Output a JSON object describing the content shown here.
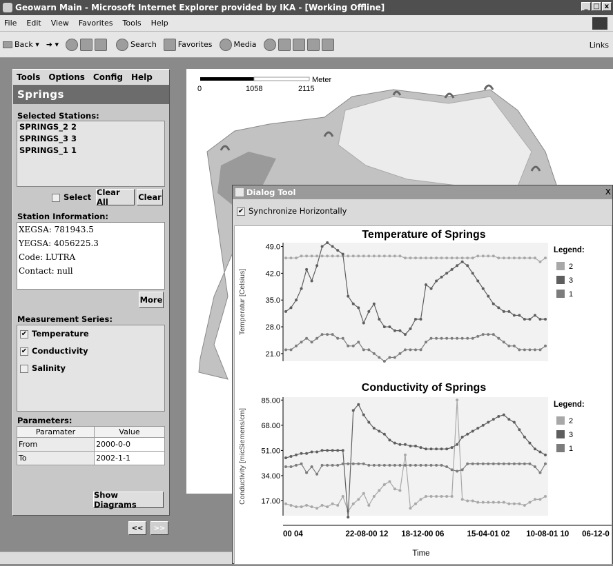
{
  "browser": {
    "title": "Geowarn Main - Microsoft Internet Explorer provided by IKA - [Working Offline]",
    "window_buttons": [
      "_",
      "□",
      "x"
    ],
    "menu": [
      "File",
      "Edit",
      "View",
      "Favorites",
      "Tools",
      "Help"
    ],
    "toolbar": {
      "back": "Back",
      "search": "Search",
      "favorites": "Favorites",
      "media": "Media",
      "links": "Links"
    }
  },
  "map": {
    "scale_unit": "Meter",
    "scale_ticks": [
      "0",
      "1058",
      "2115"
    ]
  },
  "left": {
    "menu": [
      "Tools",
      "Options",
      "Config",
      "Help"
    ],
    "title": "Springs",
    "selected_label": "Selected Stations:",
    "stations": [
      "SPRINGS_2 2",
      "SPRINGS_3 3",
      "SPRINGS_1 1"
    ],
    "select_label": "Select",
    "clear_all": "Clear All",
    "clear": "Clear",
    "info_label": "Station Information:",
    "info": [
      "XEGSA: 781943.5",
      "YEGSA: 4056225.3",
      "Code: LUTRA",
      "Contact: null"
    ],
    "more": "More",
    "series_label": "Measurement Series:",
    "series": [
      {
        "label": "Temperature",
        "checked": true
      },
      {
        "label": "Conductivity",
        "checked": true
      },
      {
        "label": "Salinity",
        "checked": false
      }
    ],
    "params_label": "Parameters:",
    "params_header": [
      "Paramater",
      "Value"
    ],
    "params": [
      [
        "From",
        "2000-0-0"
      ],
      [
        "To",
        "2002-1-1"
      ]
    ],
    "show_diagrams": "Show Diagrams",
    "nav_prev": "<<",
    "nav_next": ">>"
  },
  "dialog": {
    "title": "Dialog Tool",
    "close": "x",
    "sync_label": "Synchronize Horizontally",
    "x_ticks": [
      "00 04",
      "22-08-00 12",
      "18-12-00 06",
      "15-04-01 02",
      "10-08-01 10",
      "06-12-0"
    ],
    "x_label": "Time"
  },
  "chart_data": [
    {
      "type": "line",
      "title": "Temperature of Springs",
      "ylabel": "Temperatur [Celsius]",
      "ylim": [
        19,
        50
      ],
      "y_ticks": [
        "49.0",
        "42.0",
        "35.0",
        "28.0",
        "21.0"
      ],
      "legend_title": "Legend:",
      "legend_position": "right",
      "x": [
        0,
        2,
        4,
        6,
        8,
        10,
        12,
        14,
        16,
        18,
        20,
        22,
        24,
        26,
        28,
        30,
        32,
        34,
        36,
        38,
        40,
        42,
        44,
        46,
        48,
        50,
        52,
        54,
        56,
        58,
        60,
        62,
        64,
        66,
        68,
        70,
        72,
        74,
        76,
        78,
        80,
        82,
        84,
        86,
        88,
        90,
        92,
        94,
        96,
        98,
        100
      ],
      "series": [
        {
          "name": "2",
          "color": "#a8a8a8",
          "values": [
            46,
            46,
            46,
            46.5,
            46.5,
            46.5,
            46.5,
            46.5,
            46.5,
            46.5,
            46.5,
            46.5,
            46.5,
            46.5,
            46.5,
            46.5,
            46.5,
            46.5,
            46.5,
            46.5,
            46.5,
            46.5,
            46.5,
            46,
            46,
            46,
            46,
            46,
            46,
            46,
            46,
            46,
            46,
            46,
            46,
            46,
            46,
            46.5,
            46.5,
            46.5,
            46.5,
            46,
            46,
            46,
            46,
            46,
            46,
            46,
            46,
            45,
            46
          ]
        },
        {
          "name": "3",
          "color": "#5e5e5e",
          "values": [
            32,
            33,
            35,
            38,
            43,
            40,
            44,
            49,
            50,
            49,
            48,
            47,
            36,
            34,
            33,
            29,
            32,
            34,
            30,
            28,
            28,
            27,
            27,
            26,
            27.5,
            30,
            30,
            39,
            38,
            40,
            41,
            42,
            43,
            44,
            45,
            44,
            42,
            40,
            38,
            36,
            34,
            33,
            32,
            32,
            31,
            31,
            30,
            30,
            31,
            30,
            30
          ]
        },
        {
          "name": "1",
          "color": "#7c7c7c",
          "values": [
            22,
            22,
            23,
            24,
            25,
            24,
            25,
            26,
            26,
            26,
            25,
            25,
            23,
            23,
            24,
            22,
            22,
            21,
            20,
            19,
            20,
            20,
            21,
            22,
            22,
            22,
            22,
            24,
            25,
            25,
            25,
            25,
            25,
            25,
            25,
            25,
            25,
            25.5,
            26,
            26,
            26,
            25,
            24,
            23,
            23,
            22,
            22,
            22,
            22,
            22,
            23
          ]
        }
      ]
    },
    {
      "type": "line",
      "title": "Conductivity of Springs",
      "ylabel": "Conductivity [micSiemens/cm]",
      "ylim": [
        7,
        87
      ],
      "y_ticks": [
        "85.00",
        "68.00",
        "51.00",
        "34.00",
        "17.00"
      ],
      "legend_title": "Legend:",
      "legend_position": "right",
      "x": [
        0,
        2,
        4,
        6,
        8,
        10,
        12,
        14,
        16,
        18,
        20,
        22,
        24,
        26,
        28,
        30,
        32,
        34,
        36,
        38,
        40,
        42,
        44,
        46,
        48,
        50,
        52,
        54,
        56,
        58,
        60,
        62,
        64,
        66,
        68,
        70,
        72,
        74,
        76,
        78,
        80,
        82,
        84,
        86,
        88,
        90,
        92,
        94,
        96,
        98,
        100
      ],
      "series": [
        {
          "name": "2",
          "color": "#a8a8a8",
          "values": [
            15,
            14,
            13,
            13,
            14,
            13,
            12,
            14,
            13,
            15,
            14,
            20,
            10,
            15,
            18,
            22,
            14,
            20,
            24,
            28,
            30,
            25,
            24,
            48,
            12,
            15,
            18,
            20,
            20,
            20,
            20,
            20,
            20,
            85,
            18,
            17,
            17,
            16,
            16,
            16,
            16,
            16,
            16,
            15,
            15,
            15,
            14,
            16,
            18,
            18,
            20
          ]
        },
        {
          "name": "3",
          "color": "#5e5e5e",
          "values": [
            46,
            47,
            48,
            49,
            49,
            50,
            50,
            51,
            51,
            51,
            51,
            51,
            6,
            78,
            82,
            75,
            70,
            66,
            64,
            62,
            58,
            56,
            55,
            55,
            54,
            54,
            53,
            52,
            52,
            52,
            52,
            52,
            53,
            55,
            60,
            62,
            64,
            66,
            68,
            70,
            72,
            74,
            75,
            72,
            70,
            65,
            60,
            56,
            52,
            50,
            48
          ]
        },
        {
          "name": "1",
          "color": "#7c7c7c",
          "values": [
            40,
            40,
            41,
            42,
            36,
            40,
            35,
            41,
            41,
            41,
            41,
            42,
            42,
            42,
            42,
            42,
            41,
            41,
            41,
            41,
            41,
            41,
            41,
            41,
            41,
            41,
            41,
            41,
            41,
            41,
            41,
            40,
            38,
            37,
            38,
            42,
            42,
            42,
            42,
            42,
            42,
            42,
            42,
            42,
            42,
            42,
            42,
            42,
            40,
            36,
            42
          ]
        }
      ]
    }
  ]
}
